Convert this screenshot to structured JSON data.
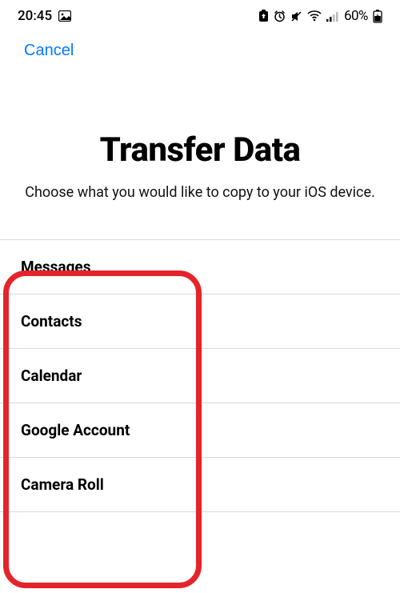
{
  "status_bar": {
    "time": "20:45",
    "battery_text": "60%"
  },
  "nav": {
    "cancel_label": "Cancel"
  },
  "header": {
    "title": "Transfer Data",
    "subtitle": "Choose what you would like to copy to your iOS device."
  },
  "list": {
    "items": [
      {
        "label": "Messages"
      },
      {
        "label": "Contacts"
      },
      {
        "label": "Calendar"
      },
      {
        "label": "Google Account"
      },
      {
        "label": "Camera Roll"
      }
    ]
  }
}
